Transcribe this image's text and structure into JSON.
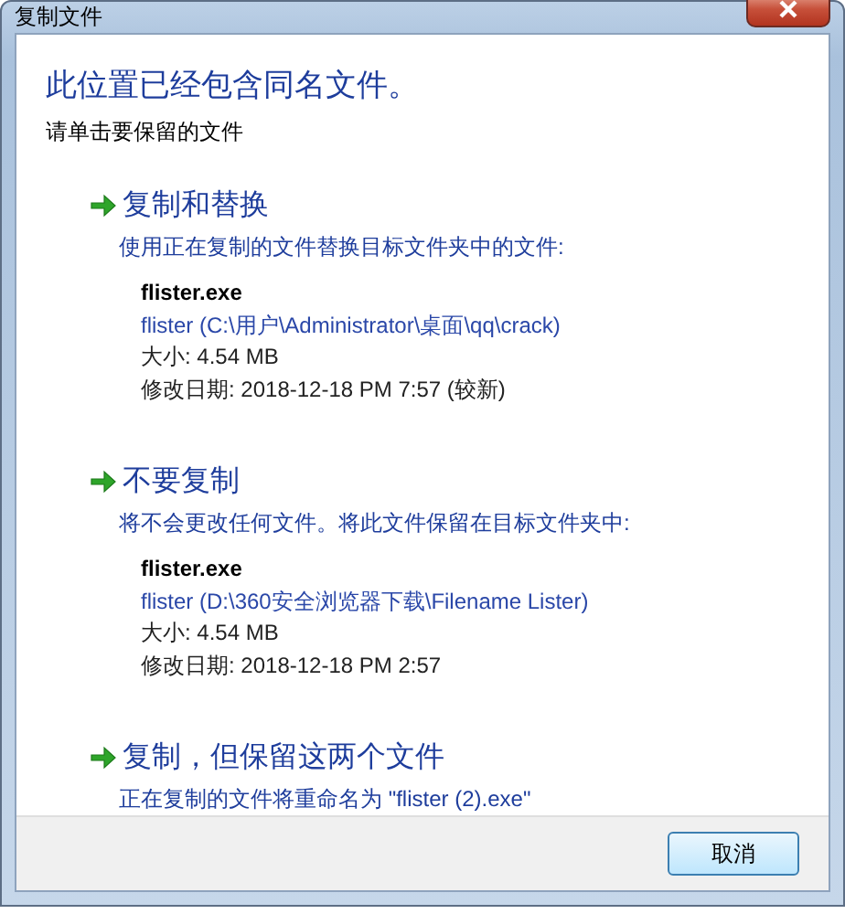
{
  "window": {
    "title": "复制文件"
  },
  "heading": "此位置已经包含同名文件。",
  "subheading": "请单击要保留的文件",
  "options": [
    {
      "title": "复制和替换",
      "description": "使用正在复制的文件替换目标文件夹中的文件:",
      "file": {
        "name": "flister.exe",
        "location": "flister (C:\\用户\\Administrator\\桌面\\qq\\crack)",
        "size": "大小: 4.54 MB",
        "modified": "修改日期: 2018-12-18 PM 7:57 (较新)"
      }
    },
    {
      "title": "不要复制",
      "description": "将不会更改任何文件。将此文件保留在目标文件夹中:",
      "file": {
        "name": "flister.exe",
        "location": "flister (D:\\360安全浏览器下载\\Filename Lister)",
        "size": "大小: 4.54 MB",
        "modified": "修改日期: 2018-12-18 PM 2:57"
      }
    },
    {
      "title": "复制，但保留这两个文件",
      "description": "正在复制的文件将重命名为 \"flister (2).exe\""
    }
  ],
  "buttons": [
    "取消"
  ]
}
